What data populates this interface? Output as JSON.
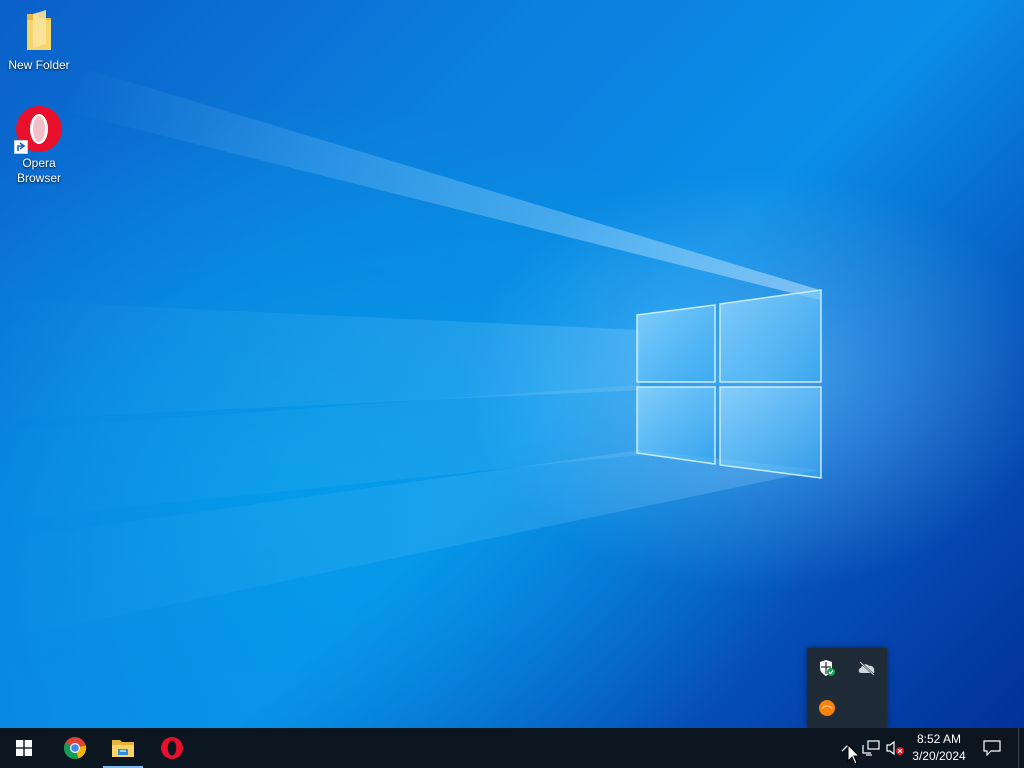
{
  "desktop": {
    "icons": [
      {
        "label": "New Folder",
        "icon": "folder-icon"
      },
      {
        "label": "Opera\nBrowser",
        "icon": "opera-icon"
      }
    ]
  },
  "taskbar": {
    "start_icon": "windows-start-icon",
    "pinned": [
      {
        "name": "Google Chrome",
        "icon": "chrome-icon"
      },
      {
        "name": "File Explorer",
        "icon": "file-explorer-icon",
        "active": true
      },
      {
        "name": "Opera",
        "icon": "opera-icon"
      }
    ],
    "tray_popup": {
      "icons": [
        "windows-security-icon",
        "onedrive-offline-icon",
        "orange-app-icon"
      ]
    },
    "system_tray": {
      "chevron_icon": "show-hidden-icons-chevron",
      "network_icon": "network-icon",
      "volume_icon": "volume-muted-icon"
    },
    "clock": {
      "time": "8:52 AM",
      "date": "3/20/2024"
    },
    "notification_icon": "action-center-icon"
  },
  "colors": {
    "taskbar_bg": "#0c1620",
    "tray_popup_bg": "#1f2b36",
    "accent": "#7fb8f0",
    "opera_red": "#e8102a"
  }
}
